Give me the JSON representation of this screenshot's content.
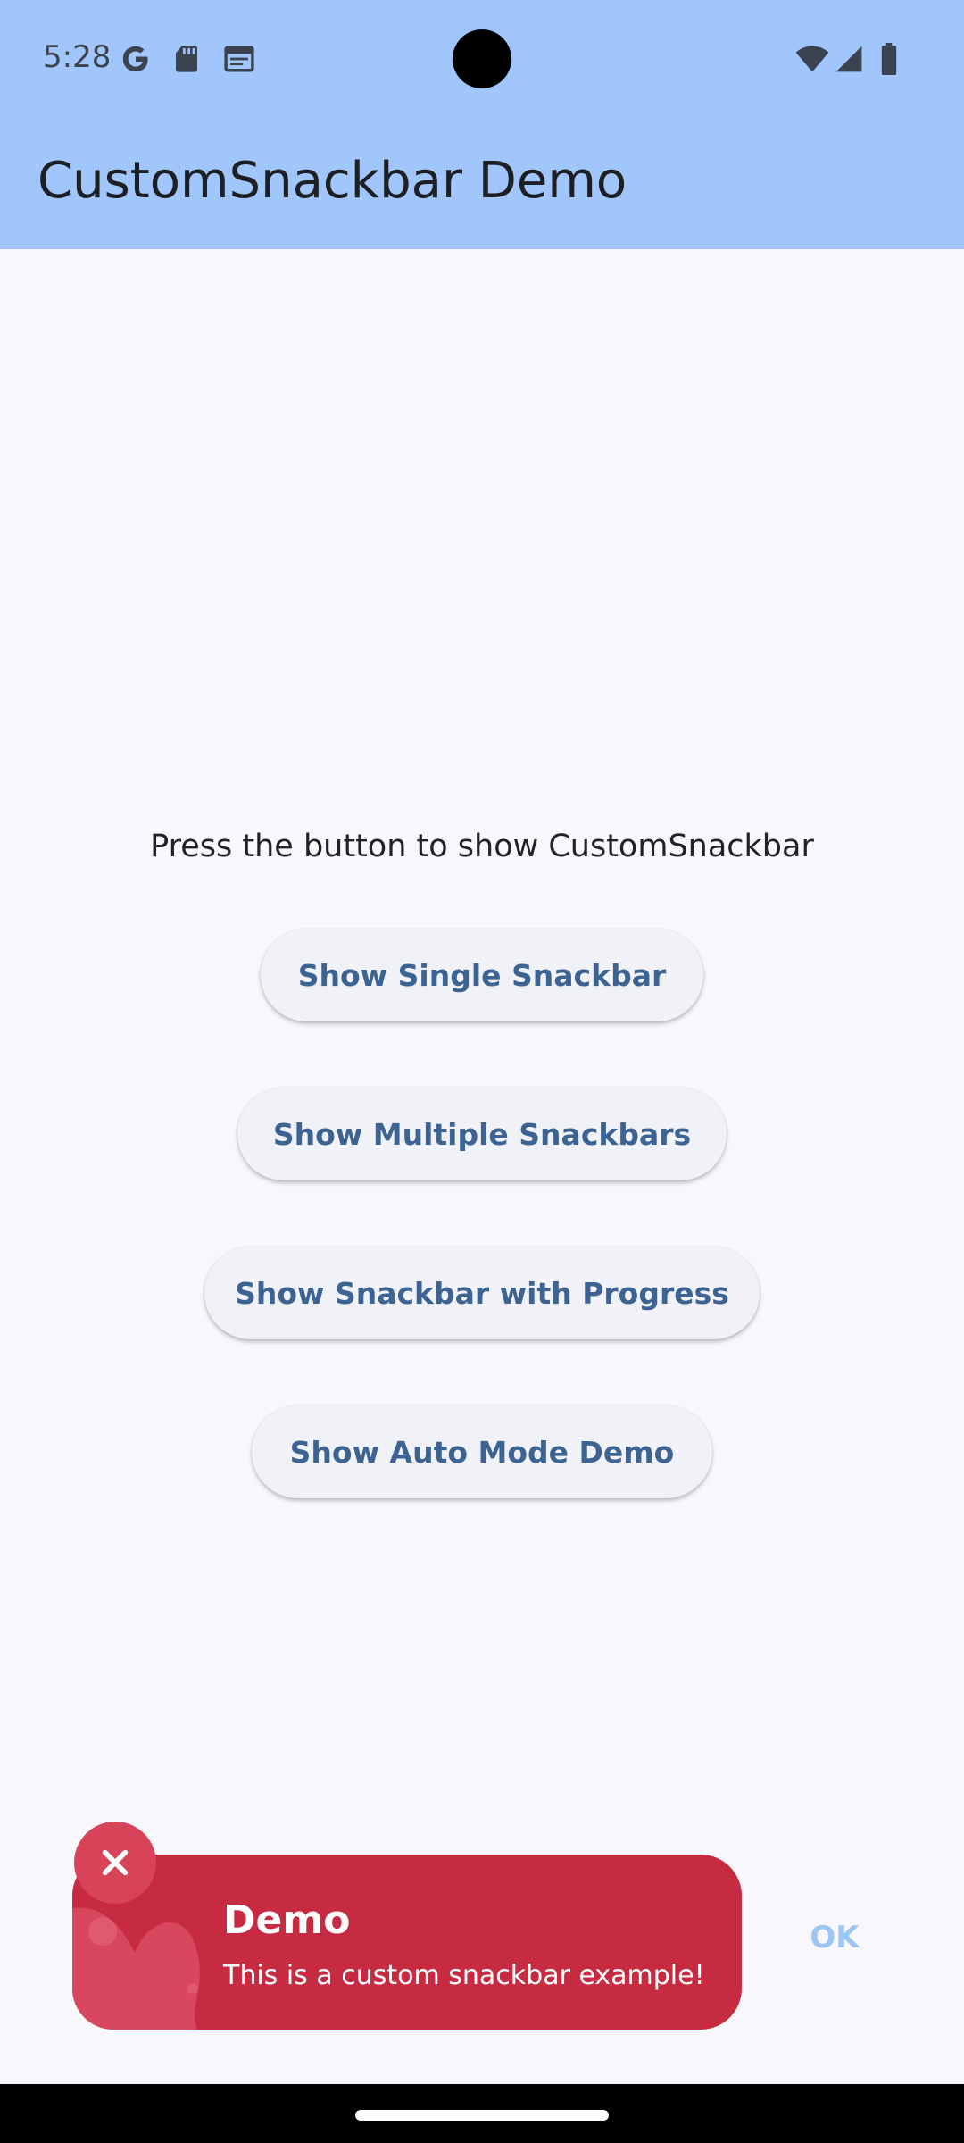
{
  "status_bar": {
    "time": "5:28",
    "icons": [
      "google-icon",
      "sd-card-icon",
      "calendar-icon",
      "wifi-icon",
      "cell-signal-icon",
      "battery-icon"
    ]
  },
  "app_bar": {
    "title": "CustomSnackbar Demo",
    "background": "#a0c6fb"
  },
  "main": {
    "prompt": "Press the button to show CustomSnackbar",
    "buttons": [
      {
        "label": "Show Single Snackbar"
      },
      {
        "label": "Show Multiple Snackbars"
      },
      {
        "label": "Show Snackbar with Progress"
      },
      {
        "label": "Show Auto Mode Demo"
      }
    ]
  },
  "snackbar": {
    "title": "Demo",
    "message": "This is a custom snackbar example!",
    "action_label": "OK",
    "close_icon": "close-icon",
    "color": "#c72b42"
  }
}
